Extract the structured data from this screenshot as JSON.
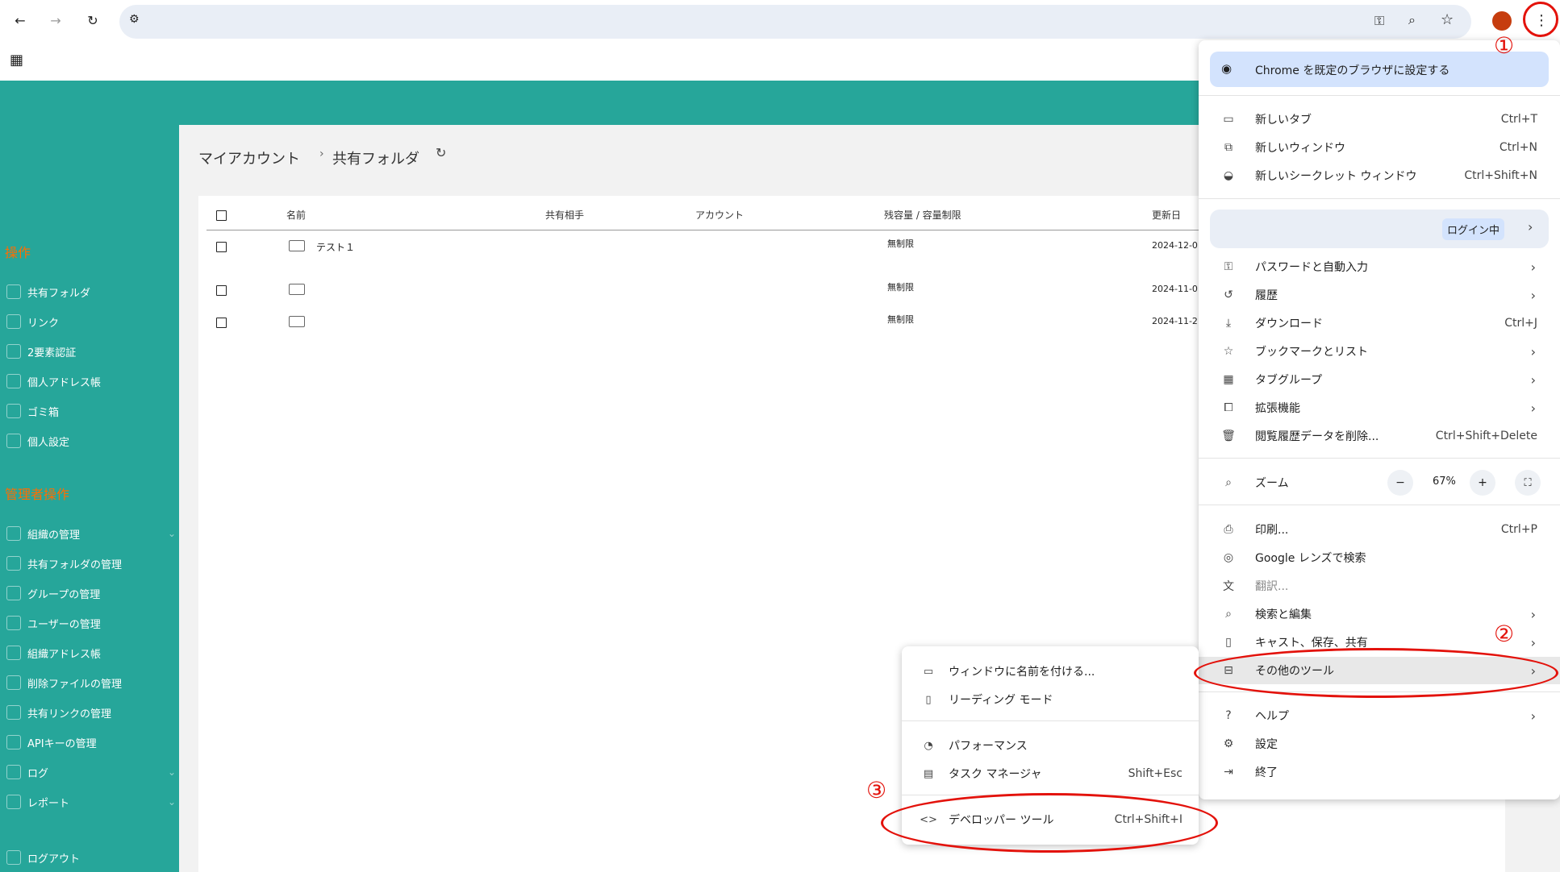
{
  "browser": {
    "zoom": "67%"
  },
  "breadcrumb": {
    "root": "マイアカウント",
    "current": "共有フォルダ"
  },
  "sidebar": {
    "section1": "操作",
    "items1": [
      "共有フォルダ",
      "リンク",
      "2要素認証",
      "個人アドレス帳",
      "ゴミ箱",
      "個人設定"
    ],
    "section2": "管理者操作",
    "items2": [
      "組織の管理",
      "共有フォルダの管理",
      "グループの管理",
      "ユーザーの管理",
      "組織アドレス帳",
      "削除ファイルの管理",
      "共有リンクの管理",
      "APIキーの管理",
      "ログ",
      "レポート"
    ],
    "logout": "ログアウト"
  },
  "table": {
    "headers": [
      "名前",
      "共有相手",
      "アカウント",
      "残容量 / 容量制限",
      "更新日"
    ],
    "rows": [
      {
        "name": "テスト１",
        "limit": "無制限",
        "date": "2024-12-0"
      },
      {
        "name": "",
        "limit": "無制限",
        "date": "2024-11-0"
      },
      {
        "name": "",
        "limit": "無制限",
        "date": "2024-11-2"
      }
    ]
  },
  "menu": {
    "default_browser": "Chrome を既定のブラウザに設定する",
    "new_tab": "新しいタブ",
    "new_tab_sc": "Ctrl+T",
    "new_window": "新しいウィンドウ",
    "new_window_sc": "Ctrl+N",
    "incognito": "新しいシークレット ウィンドウ",
    "incognito_sc": "Ctrl+Shift+N",
    "profile_status": "ログイン中",
    "passwords": "パスワードと自動入力",
    "history": "履歴",
    "downloads": "ダウンロード",
    "downloads_sc": "Ctrl+J",
    "bookmarks": "ブックマークとリスト",
    "tab_groups": "タブグループ",
    "extensions": "拡張機能",
    "clear_data": "閲覧履歴データを削除...",
    "clear_data_sc": "Ctrl+Shift+Delete",
    "zoom": "ズーム",
    "zoom_minus": "−",
    "zoom_plus": "+",
    "print": "印刷...",
    "print_sc": "Ctrl+P",
    "lens": "Google レンズで検索",
    "translate": "翻訳...",
    "find_edit": "検索と編集",
    "cast_save": "キャスト、保存、共有",
    "more_tools": "その他のツール",
    "help": "ヘルプ",
    "settings": "設定",
    "exit": "終了"
  },
  "submenu": {
    "name_window": "ウィンドウに名前を付ける...",
    "reading_mode": "リーディング モード",
    "performance": "パフォーマンス",
    "task_manager": "タスク マネージャ",
    "task_manager_sc": "Shift+Esc",
    "devtools": "デベロッパー ツール",
    "devtools_sc": "Ctrl+Shift+I"
  },
  "annotations": [
    "①",
    "②",
    "③"
  ]
}
